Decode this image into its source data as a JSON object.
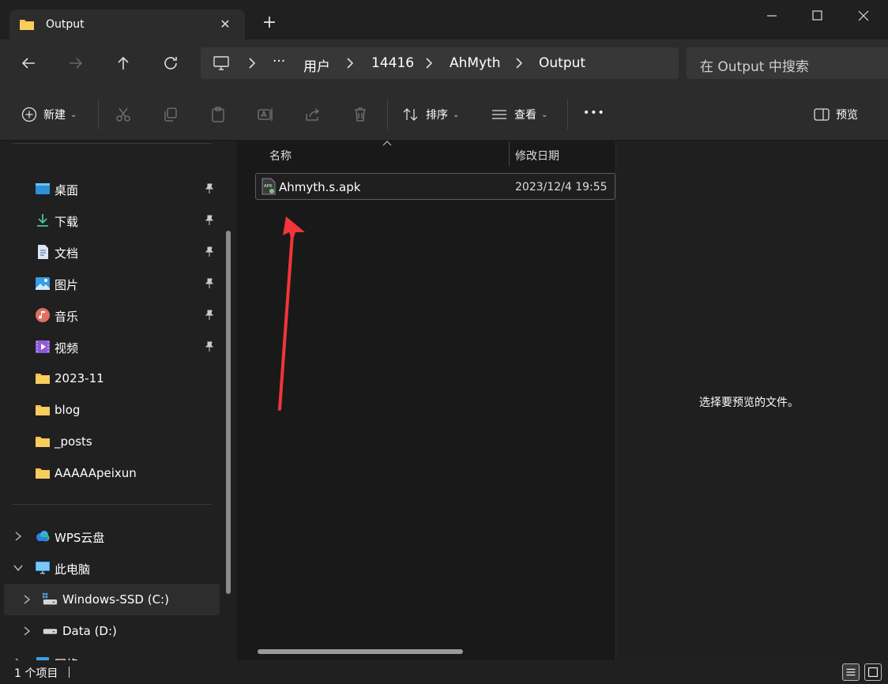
{
  "window": {
    "tab_title": "Output",
    "tab_close": "✕",
    "new_tab": "+",
    "colors": {
      "accent": "#f6c24a",
      "arrow": "#f2353a",
      "background": "#1c1c1c"
    }
  },
  "address": {
    "crumbs": [
      "···",
      "用户",
      "14416",
      "AhMyth",
      "Output"
    ]
  },
  "search": {
    "placeholder": "在 Output 中搜索"
  },
  "toolbar": {
    "new_label": "新建",
    "sort_label": "排序",
    "view_label": "查看",
    "more_label": "•••",
    "preview_label": "预览"
  },
  "sidebar": {
    "quick_access": [
      {
        "label": "桌面",
        "icon": "desktop-icon",
        "pinned": true
      },
      {
        "label": "下载",
        "icon": "download-icon",
        "pinned": true
      },
      {
        "label": "文档",
        "icon": "document-icon",
        "pinned": true
      },
      {
        "label": "图片",
        "icon": "picture-icon",
        "pinned": true
      },
      {
        "label": "音乐",
        "icon": "music-icon",
        "pinned": true
      },
      {
        "label": "视频",
        "icon": "video-icon",
        "pinned": true
      },
      {
        "label": "2023-11",
        "icon": "folder-icon",
        "pinned": false
      },
      {
        "label": "blog",
        "icon": "folder-icon",
        "pinned": false
      },
      {
        "label": "_posts",
        "icon": "folder-icon",
        "pinned": false
      },
      {
        "label": "AAAAApeixun",
        "icon": "folder-icon",
        "pinned": false
      }
    ],
    "wps": "WPS云盘",
    "this_pc": "此电脑",
    "drive_c": "Windows-SSD (C:)",
    "drive_d": "Data (D:)",
    "network": "网络"
  },
  "files": {
    "columns": {
      "name": "名称",
      "modified": "修改日期"
    },
    "rows": [
      {
        "name": "Ahmyth.s.apk",
        "modified": "2023/12/4 19:55",
        "icon": "apk-file-icon"
      }
    ]
  },
  "preview": {
    "message": "选择要预览的文件。"
  },
  "status": {
    "count": "1 个项目"
  }
}
